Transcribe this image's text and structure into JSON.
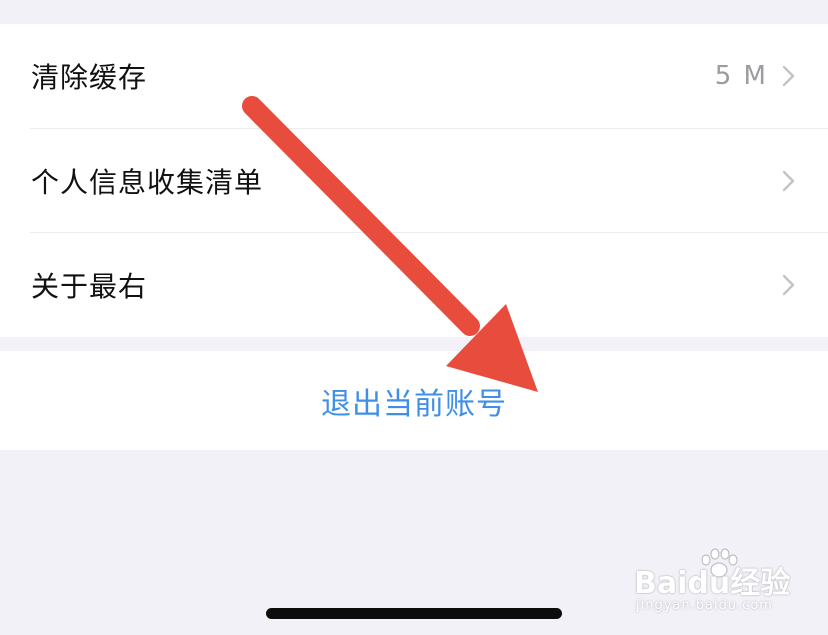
{
  "settings": {
    "items": [
      {
        "label": "清除缓存",
        "value": "5 M"
      },
      {
        "label": "个人信息收集清单",
        "value": ""
      },
      {
        "label": "关于最右",
        "value": ""
      }
    ],
    "chevron_icon": "chevron-right-icon"
  },
  "logout": {
    "label": "退出当前账号",
    "color": "#3f8fe6"
  },
  "annotation": {
    "icon": "red-arrow-icon",
    "color": "#e84c3d"
  },
  "watermark": {
    "brand": "Baidu经验",
    "site": "jingyan.baidu.com"
  },
  "colors": {
    "background": "#f2f1f7",
    "card": "#ffffff",
    "text": "#111111",
    "secondary_text": "#9c9ca0"
  }
}
